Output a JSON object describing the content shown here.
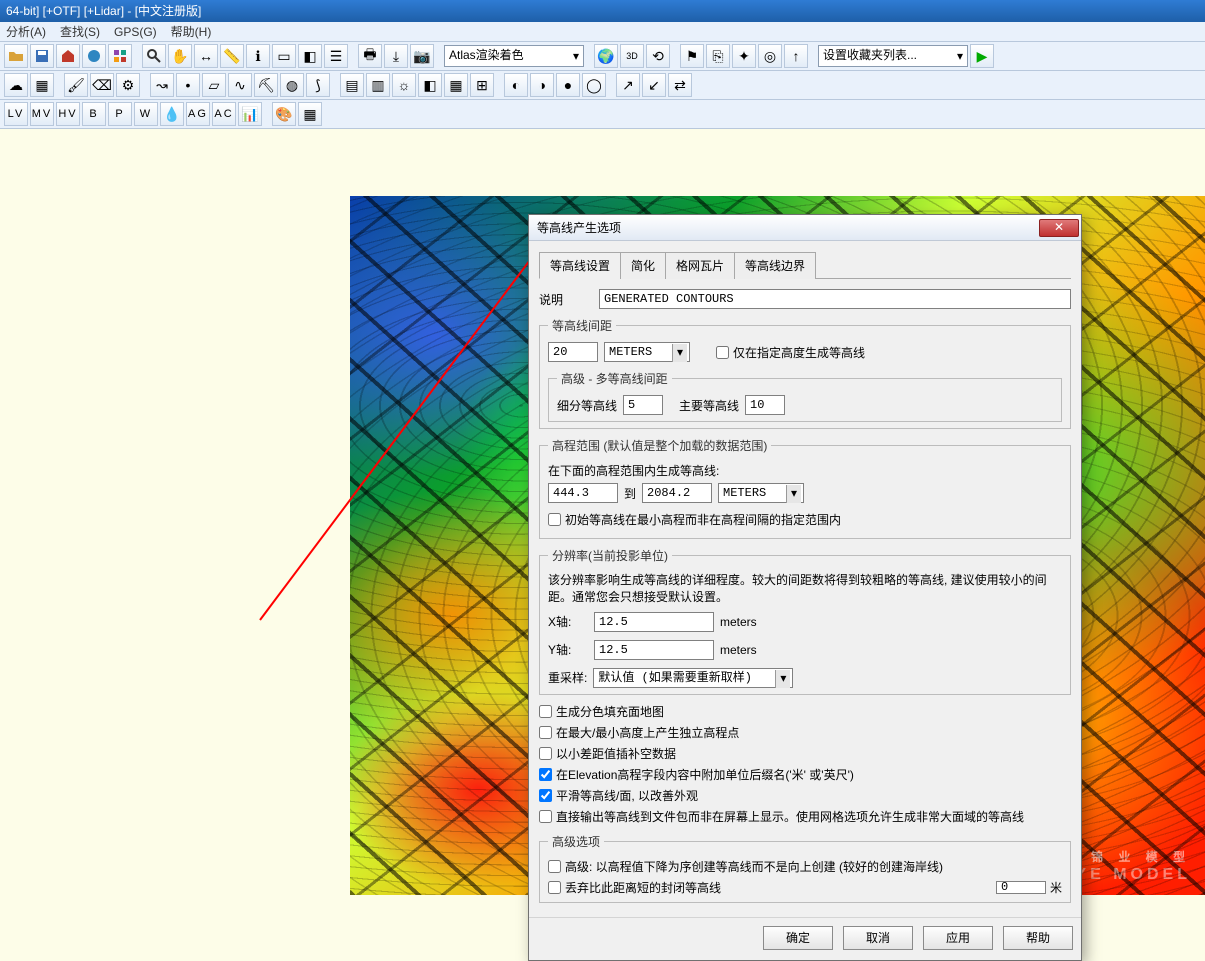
{
  "title": "64-bit] [+OTF] [+Lidar] - [中文注册版]",
  "menu": {
    "analysis": "分析(A)",
    "search": "查找(S)",
    "gps": "GPS(G)",
    "help": "帮助(H)"
  },
  "toolbar": {
    "render_mode": "Atlas渲染着色",
    "fav_list": "设置收藏夹列表..."
  },
  "dialog": {
    "title": "等高线产生选项",
    "tabs": {
      "settings": "等高线设置",
      "simplify": "简化",
      "tiles": "格网瓦片",
      "bounds": "等高线边界"
    },
    "desc_label": "说明",
    "desc_value": "GENERATED CONTOURS",
    "interval_group": "等高线间距",
    "interval_value": "20",
    "interval_unit": "METERS",
    "only_at_heights": "仅在指定高度生成等高线",
    "adv_multi": "高级 - 多等高线间距",
    "minor_lbl": "细分等高线",
    "minor_val": "5",
    "major_lbl": "主要等高线",
    "major_val": "10",
    "elev_group": "高程范围 (默认值是整个加载的数据范围)",
    "elev_line": "在下面的高程范围内生成等高线:",
    "elev_from": "444.3",
    "elev_to_lbl": "到",
    "elev_to": "2084.2",
    "elev_unit": "METERS",
    "elev_start_min": "初始等高线在最小高程而非在高程间隔的指定范围内",
    "res_group": "分辨率(当前投影单位)",
    "res_text": "该分辨率影响生成等高线的详细程度。较大的间距数将得到较粗略的等高线, 建议使用较小的间距。通常您会只想接受默认设置。",
    "x_lbl": "X轴:",
    "x_val": "12.5",
    "x_unit": "meters",
    "y_lbl": "Y轴:",
    "y_val": "12.5",
    "y_unit": "meters",
    "resample_lbl": "重采样:",
    "resample_val": "默认值 (如果需要重新取样)",
    "opts": {
      "fill_color": "生成分色填充面地图",
      "spot_heights": "在最大/最小高度上产生独立高程点",
      "interp_small": "以小差距值插补空数据",
      "append_unit": "在Elevation高程字段内容中附加单位后缀名('米' 或'英尺')",
      "smooth": "平滑等高线/面, 以改善外观",
      "direct_out": "直接输出等高线到文件包而非在屏幕上显示。使用网格选项允许生成非常大面域的等高线"
    },
    "adv_group": "高级选项",
    "adv_desc": "高级: 以高程值下降为序创建等高线而不是向上创建 (较好的创建海岸线)",
    "discard_lbl": "丢弃比此距离短的封闭等高线",
    "discard_val": "0",
    "discard_unit": "米",
    "btns": {
      "ok": "确定",
      "cancel": "取消",
      "apply": "应用",
      "help": "帮助"
    }
  },
  "watermark": {
    "cn": "锦 业 模 型",
    "en": "JINYE  MODEL"
  }
}
